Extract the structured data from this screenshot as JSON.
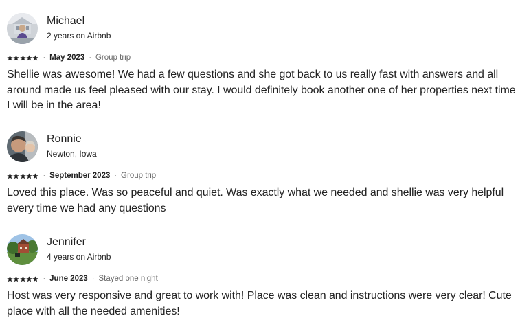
{
  "reviews": [
    {
      "name": "Michael",
      "subtitle": "2 years on Airbnb",
      "rating": 5,
      "date": "May 2023",
      "trip_type": "Group trip",
      "text": "Shellie was awesome! We had a few questions and she got back to us really fast with answers and all around made us feel pleased with our stay. I would definitely book another one of her properties next time I will be in the area!"
    },
    {
      "name": "Ronnie",
      "subtitle": "Newton, Iowa",
      "rating": 5,
      "date": "September 2023",
      "trip_type": "Group trip",
      "text": "Loved this place. Was so peaceful and quiet. Was exactly what we needed and shellie was very helpful every time we had any questions"
    },
    {
      "name": "Jennifer",
      "subtitle": "4 years on Airbnb",
      "rating": 5,
      "date": "June 2023",
      "trip_type": "Stayed one night",
      "text": "Host was very responsive and great to work with! Place was clean and instructions were very clear! Cute place with all the needed amenities!"
    }
  ],
  "separator": "·",
  "colors": {
    "text_primary": "#222222",
    "text_secondary": "#6a6a6a",
    "star": "#222222"
  },
  "icons": {
    "star": "star-icon"
  }
}
